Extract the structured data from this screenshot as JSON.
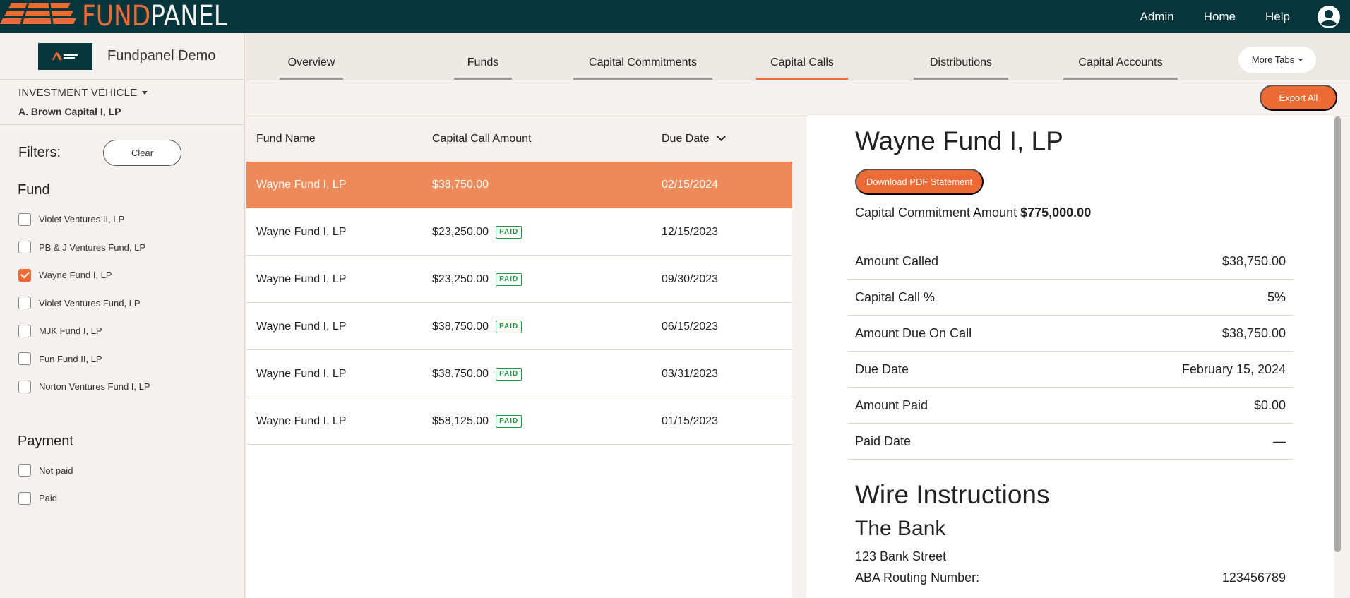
{
  "brand": {
    "name_part1": "FUND",
    "name_part2": "PANEL",
    "accent": "#ee6a35",
    "nav_bg": "#06363c"
  },
  "topnav": {
    "items": [
      "Admin",
      "Home",
      "Help"
    ],
    "user_icon": "user-circle-icon"
  },
  "sidebar": {
    "org_name": "Fundpanel Demo",
    "investment_vehicle_label": "INVESTMENT VEHICLE",
    "investment_vehicle_value": "A. Brown Capital I, LP",
    "filters_title": "Filters:",
    "clear_label": "Clear",
    "fund_group_title": "Fund",
    "funds": [
      {
        "label": "Violet Ventures II, LP",
        "checked": false
      },
      {
        "label": "PB & J Ventures Fund, LP",
        "checked": false
      },
      {
        "label": "Wayne Fund I, LP",
        "checked": true
      },
      {
        "label": "Violet Ventures Fund, LP",
        "checked": false
      },
      {
        "label": "MJK Fund I, LP",
        "checked": false
      },
      {
        "label": "Fun Fund II, LP",
        "checked": false
      },
      {
        "label": "Norton Ventures Fund I, LP",
        "checked": false
      }
    ],
    "payment_group_title": "Payment",
    "payments": [
      {
        "label": "Not paid",
        "checked": false
      },
      {
        "label": "Paid",
        "checked": false
      }
    ]
  },
  "tabs": {
    "items": [
      "Overview",
      "Funds",
      "Capital Commitments",
      "Capital Calls",
      "Distributions",
      "Capital Accounts"
    ],
    "active": "Capital Calls",
    "more_label": "More Tabs"
  },
  "actions": {
    "export_label": "Export All"
  },
  "table": {
    "headers": [
      "Fund Name",
      "Capital Call Amount",
      "Due Date"
    ],
    "paid_badge": "PAID",
    "rows": [
      {
        "fund": "Wayne Fund I, LP",
        "amount": "$38,750.00",
        "paid": false,
        "due": "02/15/2024",
        "selected": true
      },
      {
        "fund": "Wayne Fund I, LP",
        "amount": "$23,250.00",
        "paid": true,
        "due": "12/15/2023",
        "selected": false
      },
      {
        "fund": "Wayne Fund I, LP",
        "amount": "$23,250.00",
        "paid": true,
        "due": "09/30/2023",
        "selected": false
      },
      {
        "fund": "Wayne Fund I, LP",
        "amount": "$38,750.00",
        "paid": true,
        "due": "06/15/2023",
        "selected": false
      },
      {
        "fund": "Wayne Fund I, LP",
        "amount": "$38,750.00",
        "paid": true,
        "due": "03/31/2023",
        "selected": false
      },
      {
        "fund": "Wayne Fund I, LP",
        "amount": "$58,125.00",
        "paid": true,
        "due": "01/15/2023",
        "selected": false
      }
    ]
  },
  "detail": {
    "title": "Wayne Fund I, LP",
    "pdf_label": "Download PDF Statement",
    "commitment_label": "Capital Commitment Amount",
    "commitment_value": "$775,000.00",
    "fields": [
      {
        "label": "Amount Called",
        "value": "$38,750.00"
      },
      {
        "label": "Capital Call %",
        "value": "5%"
      },
      {
        "label": "Amount Due On Call",
        "value": "$38,750.00"
      },
      {
        "label": "Due Date",
        "value": "February 15, 2024"
      },
      {
        "label": "Amount Paid",
        "value": "$0.00"
      },
      {
        "label": "Paid Date",
        "value": "—"
      }
    ],
    "wire_title": "Wire Instructions",
    "bank_name": "The Bank",
    "bank_address": "123 Bank Street",
    "aba_label": "ABA Routing Number:",
    "aba_value": "123456789"
  }
}
